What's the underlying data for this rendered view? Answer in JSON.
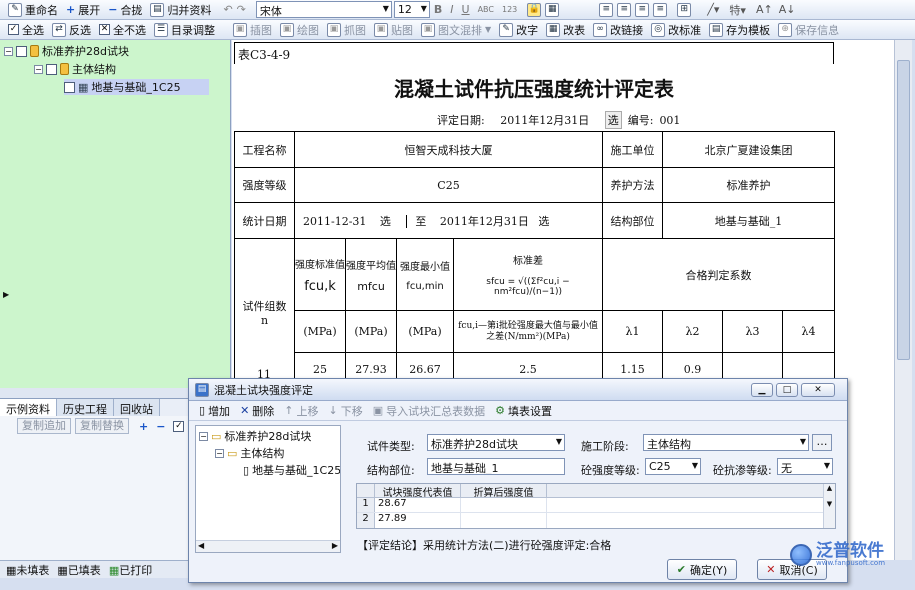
{
  "toolbar_row1_left": [
    {
      "icon": "rename-icon",
      "label": "重命名"
    },
    {
      "icon": "plus-icon",
      "label": "展开"
    },
    {
      "icon": "minus-icon",
      "label": "合拢"
    },
    {
      "icon": "archive-icon",
      "label": "归并资料"
    }
  ],
  "font": {
    "name": "宋体",
    "size": "12"
  },
  "toolbar_row2_left": [
    {
      "icon": "check-all-icon",
      "label": "全选"
    },
    {
      "icon": "invert-icon",
      "label": "反选"
    },
    {
      "icon": "uncheck-icon",
      "label": "全不选"
    },
    {
      "icon": "catalog-icon",
      "label": "目录调整"
    }
  ],
  "toolbar_row2_right": [
    {
      "label": "插图",
      "enabled": false
    },
    {
      "label": "绘图",
      "enabled": false
    },
    {
      "label": "抓图",
      "enabled": false
    },
    {
      "label": "贴图",
      "enabled": false
    },
    {
      "label": "图文混排",
      "enabled": false
    },
    {
      "label": "改字",
      "enabled": true
    },
    {
      "label": "改表",
      "enabled": true
    },
    {
      "label": "改链接",
      "enabled": true
    },
    {
      "label": "改标准",
      "enabled": true
    },
    {
      "label": "存为模板",
      "enabled": true
    },
    {
      "label": "保存信息",
      "enabled": false
    }
  ],
  "tree": [
    {
      "label": "标准养护28d试块",
      "level": 0
    },
    {
      "label": "主体结构",
      "level": 1
    },
    {
      "label": "地基与基础_1C25",
      "level": 2
    }
  ],
  "bottom_tabs": [
    "示例资料",
    "历史工程",
    "回收站"
  ],
  "bottom_buttons": [
    "复制追加",
    "复制替换"
  ],
  "status_tabs": [
    "未填表",
    "已填表",
    "已打印"
  ],
  "document": {
    "code": "表C3-4-9",
    "title": "混凝土试件抗压强度统计评定表",
    "eval_date_label": "评定日期:",
    "eval_date": "2011年12月31日",
    "select_btn": "选",
    "number_label": "编号:",
    "number": "001",
    "project_name_label": "工程名称",
    "project_name": "恒智天成科技大厦",
    "construction_unit_label": "施工单位",
    "construction_unit": "北京广夏建设集团",
    "strength_grade_label": "强度等级",
    "strength_grade": "C25",
    "curing_method_label": "养护方法",
    "curing_method": "标准养护",
    "stat_date_label": "统计日期",
    "stat_date_from": "2011-12-31",
    "to_label": "至",
    "stat_date_to": "2011年12月31日",
    "structure_part_label": "结构部位",
    "structure_part": "地基与基础_1",
    "head_groups": "试件组数n",
    "head_std": "强度标准值",
    "head_avg": "强度平均值",
    "head_min": "强度最小值",
    "head_sd": "标准差",
    "head_coef": "合格判定系数",
    "sym_fcuk": "fcu,k",
    "sym_mfcu": "mfcu",
    "sym_fmin": "fcu,min",
    "formula": "sfcu = √((Σf²cu,i − nm²fcu)/(n−1))",
    "unit": "(MPa)",
    "note": "fcu,i—第i批砼强度最大值与最小值之差(N/mm²)(MPa)",
    "lambdas": [
      "λ1",
      "λ2",
      "λ3",
      "λ4"
    ],
    "values": {
      "n": "11",
      "std": "25",
      "avg": "27.93",
      "min": "26.67",
      "sd": "2.5",
      "l1": "1.15",
      "l2": "0.9",
      "l3": "",
      "l4": ""
    }
  },
  "dialog": {
    "title": "混凝土试块强度评定",
    "toolbar": [
      {
        "label": "增加",
        "enabled": true
      },
      {
        "label": "删除",
        "enabled": true
      },
      {
        "label": "上移",
        "enabled": false
      },
      {
        "label": "下移",
        "enabled": false
      },
      {
        "label": "导入试块汇总表数据",
        "enabled": false
      },
      {
        "label": "填表设置",
        "enabled": true
      }
    ],
    "tree": [
      "标准养护28d试块",
      "主体结构",
      "地基与基础_1C25"
    ],
    "specimen_type_label": "试件类型:",
    "specimen_type": "标准养护28d试块",
    "stage_label": "施工阶段:",
    "stage": "主体结构",
    "part_label": "结构部位:",
    "part": "地基与基础_1",
    "grade_label": "砼强度等级:",
    "grade": "C25",
    "impermeability_label": "砼抗渗等级:",
    "impermeability": "无",
    "grid_headers": [
      "试块强度代表值",
      "折算后强度值"
    ],
    "grid_rows": [
      {
        "no": "1",
        "value": "28.67",
        "converted": ""
      },
      {
        "no": "2",
        "value": "27.89",
        "converted": ""
      }
    ],
    "conclusion": "【评定结论】采用统计方法(二)进行砼强度评定:合格",
    "ok": "确定(Y)",
    "cancel": "取消(C)"
  },
  "watermark": "泛普软件",
  "watermark_url": "www.fanpusoft.com"
}
